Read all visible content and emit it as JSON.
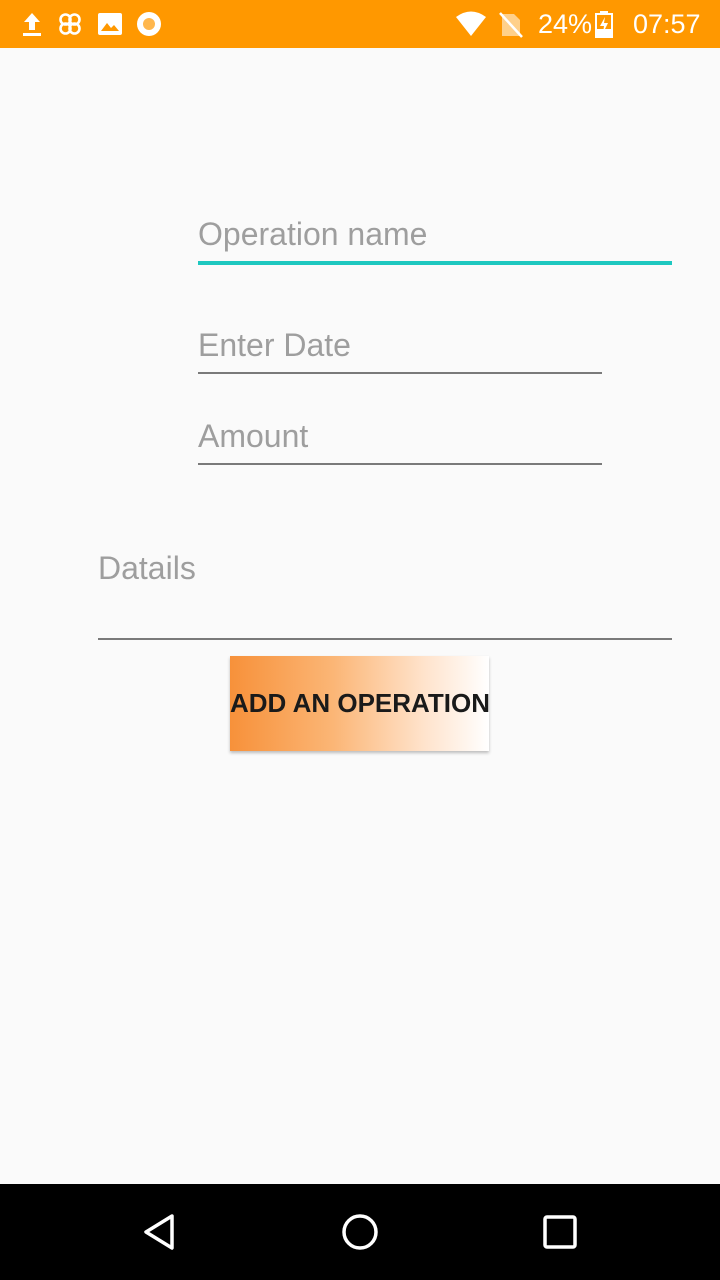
{
  "status_bar": {
    "background": "#ff9800",
    "left_icons": [
      "upload-icon",
      "clover-icon",
      "image-icon",
      "record-icon"
    ],
    "right_icons": [
      "wifi-icon",
      "no-sim-icon",
      "battery-charging-icon"
    ],
    "battery_text": "24%",
    "time": "07:57"
  },
  "form": {
    "operation_name": {
      "value": "",
      "placeholder": "Operation name",
      "focused": true
    },
    "date": {
      "value": "",
      "placeholder": "Enter Date"
    },
    "amount": {
      "value": "",
      "placeholder": "Amount"
    },
    "details": {
      "value": "",
      "placeholder": "Datails"
    },
    "focus_color": "#1ec8c0"
  },
  "add_button": {
    "label": "ADD AN OPERATION",
    "gradient": [
      "#f7913a",
      "#ffffff"
    ]
  },
  "nav_bar": {
    "buttons": [
      "back-icon",
      "home-icon",
      "recents-icon"
    ]
  }
}
